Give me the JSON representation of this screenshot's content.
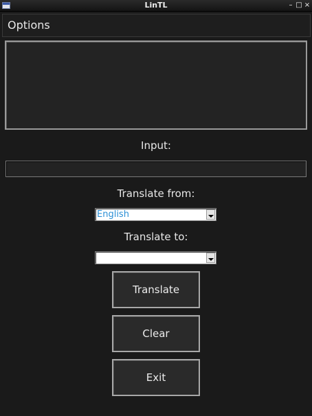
{
  "window": {
    "title": "LinTL",
    "controls": {
      "minimize": "–",
      "maximize": "□",
      "close": "×"
    }
  },
  "menu": {
    "options_label": "Options"
  },
  "output": {
    "text": ""
  },
  "input": {
    "label": "Input:",
    "value": ""
  },
  "translate_from": {
    "label": "Translate from:",
    "selected": "English"
  },
  "translate_to": {
    "label": "Translate to:",
    "selected": ""
  },
  "buttons": {
    "translate": "Translate",
    "clear": "Clear",
    "exit": "Exit"
  },
  "colors": {
    "background": "#1a1a1a",
    "text": "#e8e8e8",
    "select_text": "#2a8fd6"
  }
}
